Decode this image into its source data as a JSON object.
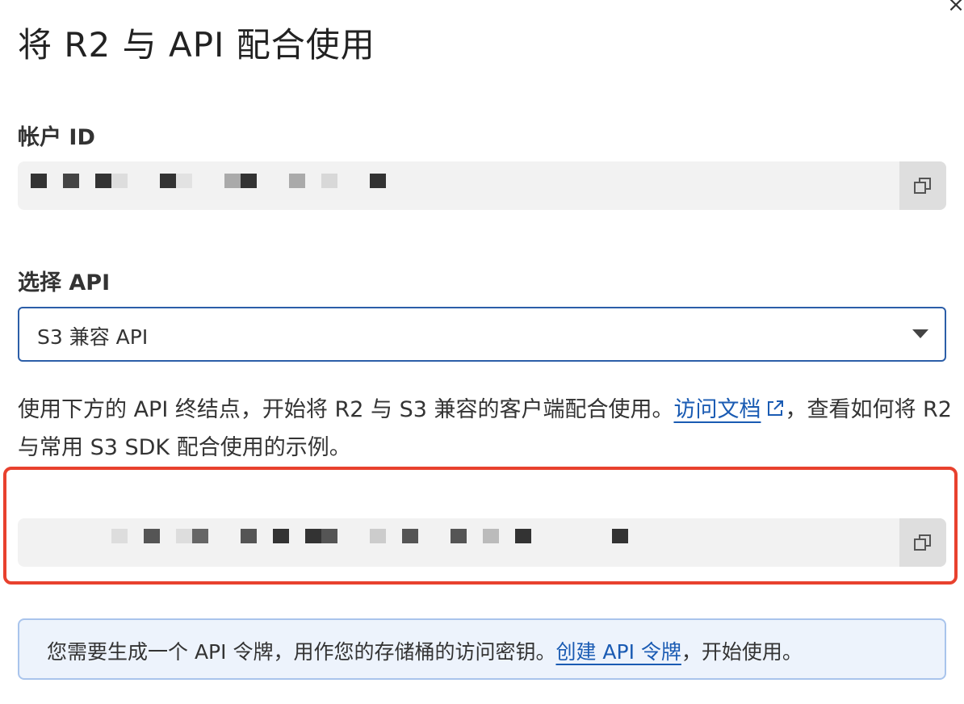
{
  "dialog": {
    "title": "将 R2 与 API 配合使用"
  },
  "account": {
    "label": "帐户 ID",
    "value_masked": true
  },
  "api_select": {
    "label": "选择 API",
    "selected": "S3 兼容 API"
  },
  "description": {
    "text_before": "使用下方的 API 终结点，开始将 R2 与 S3 兼容的客户端配合使用。",
    "link": "访问文档",
    "text_after": "，查看如何将 R2 与常用 S3 SDK 配合使用的示例。"
  },
  "endpoint": {
    "value_masked": true
  },
  "info_banner": {
    "text_before": "您需要生成一个 API 令牌，用作您的存储桶的访问密钥。",
    "link": "创建 API 令牌",
    "text_after": "，开始使用。"
  },
  "icons": {
    "close": "close-icon",
    "copy": "copy-icon",
    "external": "external-link-icon",
    "caret": "chevron-down-icon"
  },
  "colors": {
    "link": "#1a5bb3",
    "select_border": "#2c5ea8",
    "highlight": "#e8412e",
    "info_background": "#edf3fc",
    "info_border": "#a9c4ec"
  }
}
